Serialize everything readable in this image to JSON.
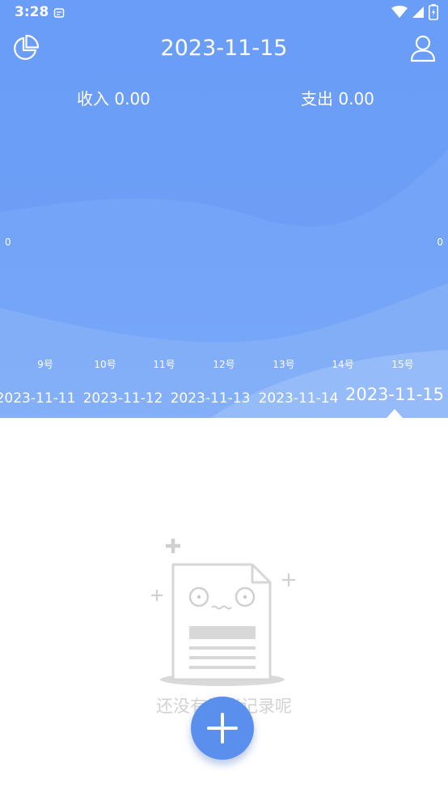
{
  "status_bar": {
    "time": "3:28",
    "icons": [
      "notification-icon",
      "wifi-icon",
      "signal-icon",
      "battery-icon"
    ]
  },
  "header": {
    "date": "2023-11-15",
    "left_icon": "pie-chart-icon",
    "right_icon": "user-icon"
  },
  "summary": {
    "income_label": "收入 0.00",
    "expense_label": "支出 0.00"
  },
  "chart_axis": {
    "left_value": "0",
    "right_value": "0"
  },
  "day_labels": [
    "9号",
    "10号",
    "11号",
    "12号",
    "13号",
    "14号",
    "15号"
  ],
  "date_strip": {
    "items": [
      "2023-11-11",
      "2023-11-12",
      "2023-11-13",
      "2023-11-14",
      "2023-11-15"
    ],
    "selected": "2023-11-15"
  },
  "empty_state": {
    "message": "还没有记账记录呢"
  },
  "fab": {
    "icon": "plus-icon"
  },
  "colors": {
    "primary": "#6a9df7",
    "fab": "#5b8fed",
    "empty_text": "#d2d2d2"
  }
}
